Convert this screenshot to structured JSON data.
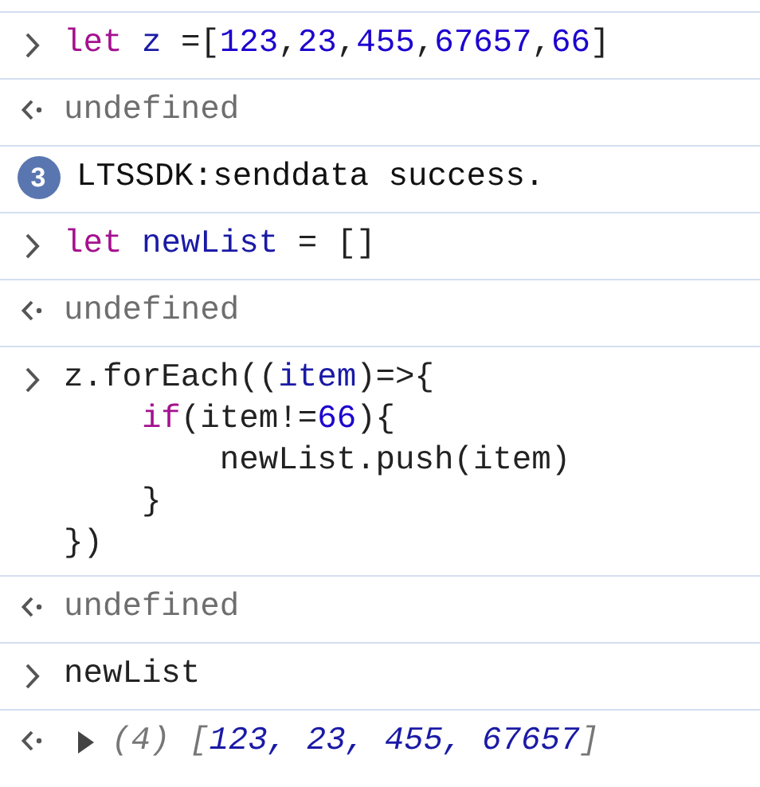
{
  "entries": [
    {
      "kind": "input",
      "lines": [
        {
          "tokens": [
            {
              "kind": "keyword",
              "text": "let "
            },
            {
              "kind": "variable",
              "text": "z "
            },
            {
              "kind": "plain",
              "text": "=["
            },
            {
              "kind": "number",
              "text": "123"
            },
            {
              "kind": "plain",
              "text": ","
            },
            {
              "kind": "number",
              "text": "23"
            },
            {
              "kind": "plain",
              "text": ","
            },
            {
              "kind": "number",
              "text": "455"
            },
            {
              "kind": "plain",
              "text": ","
            },
            {
              "kind": "number",
              "text": "67657"
            },
            {
              "kind": "plain",
              "text": ","
            },
            {
              "kind": "number",
              "text": "66"
            },
            {
              "kind": "plain",
              "text": "]"
            }
          ]
        }
      ]
    },
    {
      "kind": "output",
      "text": "undefined"
    },
    {
      "kind": "log",
      "count": "3",
      "text": "LTSSDK:senddata success."
    },
    {
      "kind": "input",
      "lines": [
        {
          "tokens": [
            {
              "kind": "keyword",
              "text": "let "
            },
            {
              "kind": "variable",
              "text": "newList "
            },
            {
              "kind": "plain",
              "text": "= []"
            }
          ]
        }
      ]
    },
    {
      "kind": "output",
      "text": "undefined"
    },
    {
      "kind": "input",
      "lines": [
        {
          "tokens": [
            {
              "kind": "plain",
              "text": "z.forEach(("
            },
            {
              "kind": "variable",
              "text": "item"
            },
            {
              "kind": "plain",
              "text": ")=>{"
            }
          ],
          "children": [
            {
              "tokens": [
                {
                  "kind": "keyword",
                  "text": "if"
                },
                {
                  "kind": "plain",
                  "text": "(item!="
                },
                {
                  "kind": "number",
                  "text": "66"
                },
                {
                  "kind": "plain",
                  "text": "){"
                }
              ],
              "children": [
                {
                  "tokens": [
                    {
                      "kind": "plain",
                      "text": "newList.push(item)"
                    }
                  ]
                }
              ]
            },
            {
              "tokens": [
                {
                  "kind": "plain",
                  "text": "}"
                }
              ]
            }
          ]
        },
        {
          "tokens": [
            {
              "kind": "plain",
              "text": "})"
            }
          ]
        }
      ]
    },
    {
      "kind": "output",
      "text": "undefined"
    },
    {
      "kind": "input",
      "lines": [
        {
          "tokens": [
            {
              "kind": "plain",
              "text": "newList"
            }
          ]
        }
      ]
    },
    {
      "kind": "array",
      "expanded": false,
      "tokens": [
        {
          "kind": "meta",
          "text": "(4) ["
        },
        {
          "kind": "value",
          "text": "123, 23, 455, 67657"
        },
        {
          "kind": "meta",
          "text": "]"
        }
      ]
    }
  ]
}
